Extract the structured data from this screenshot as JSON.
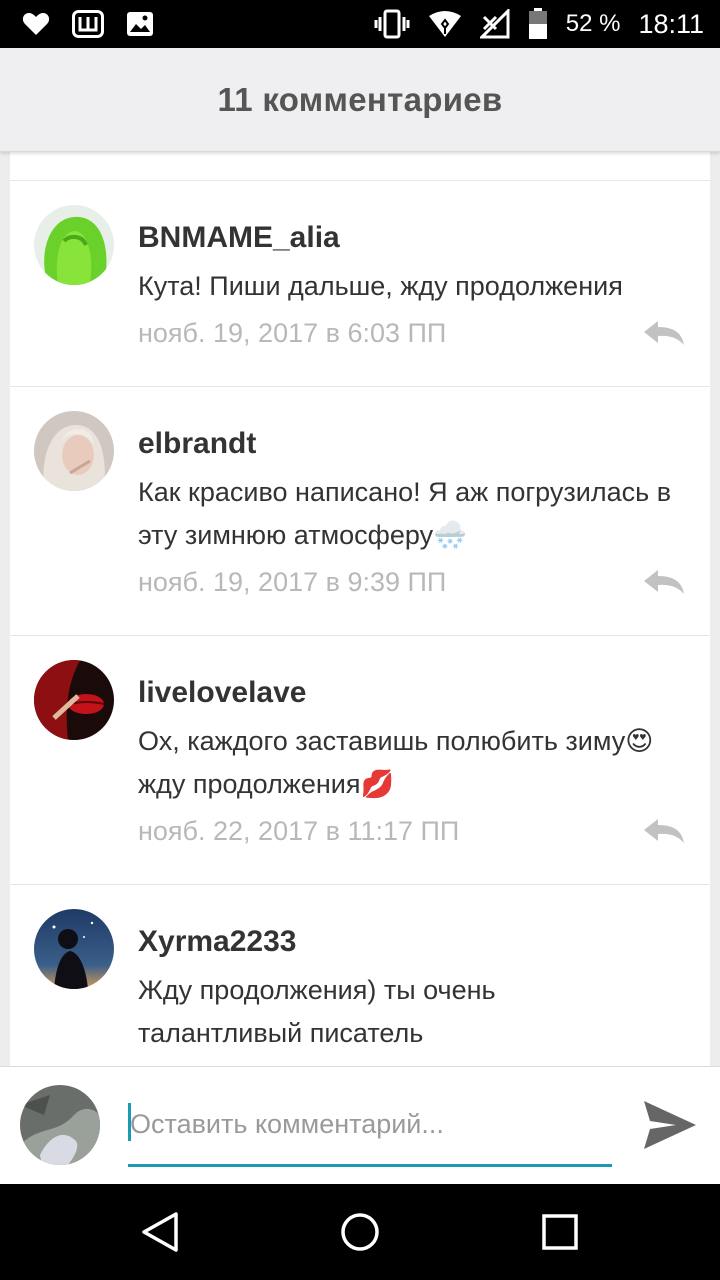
{
  "status_bar": {
    "battery": "52 %",
    "time": "18:11",
    "icons": [
      "heart-icon",
      "w-app-icon",
      "image-icon",
      "vibrate-icon",
      "wifi-icon",
      "no-signal-icon",
      "battery-icon"
    ]
  },
  "header": {
    "title": "11 комментариев"
  },
  "comments": [
    {
      "username": "BNMAME_alia",
      "text": "Кута! Пиши дальше, жду продолжения",
      "date": "нояб. 19, 2017 в 6:03 ПП"
    },
    {
      "username": "elbrandt",
      "text": "Как красиво написано! Я аж погрузилась в эту зимнюю атмосферу🌨️",
      "date": "нояб. 19, 2017 в 9:39 ПП"
    },
    {
      "username": "livelovelave",
      "text": "Ох, каждого заставишь полюбить зиму😍 жду продолжения💋",
      "date": "нояб. 22, 2017 в 11:17 ПП"
    },
    {
      "username": "Xyrma2233",
      "text": "Жду продолжения) ты очень талантливый писатель",
      "date": ""
    }
  ],
  "composer": {
    "placeholder": "Оставить комментарий...",
    "value": ""
  },
  "colors": {
    "accent": "#1a9bb3",
    "date_gray": "#b8b8b8",
    "header_bg": "#efeef0"
  }
}
